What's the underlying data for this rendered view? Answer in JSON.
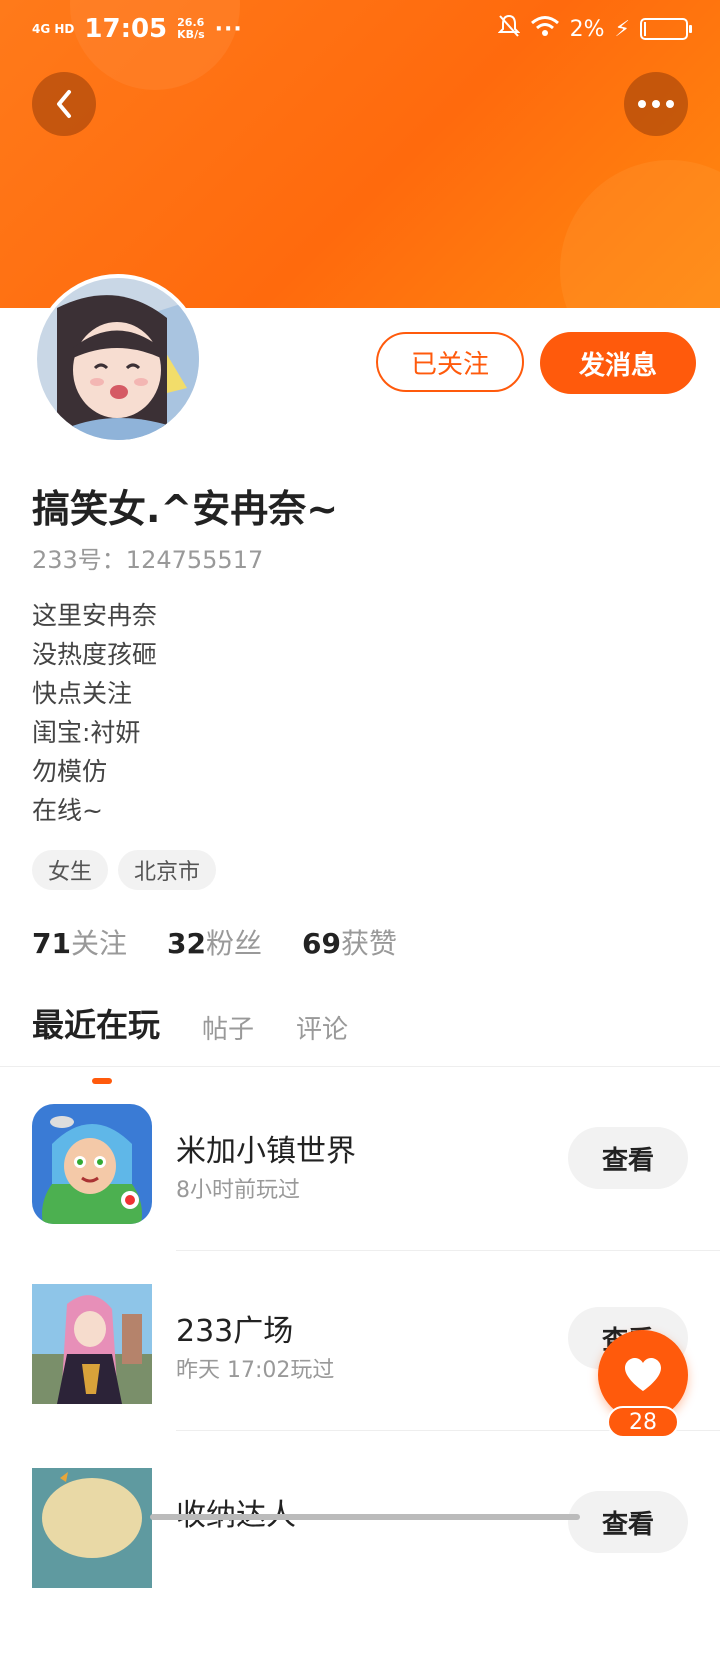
{
  "status_bar": {
    "network": "4G HD",
    "time": "17:05",
    "speed_value": "26.6",
    "speed_unit": "KB/s",
    "more": "···",
    "battery": "2%"
  },
  "profile": {
    "name": "搞笑女.^安冉奈~",
    "uid": "233号：124755517",
    "bio": [
      "这里安冉奈",
      "没热度孩砸",
      "快点关注",
      "闺宝:衬妍",
      "勿模仿",
      "在线~"
    ],
    "tags": [
      "女生",
      "北京市"
    ],
    "stats": [
      {
        "num": "71",
        "label": "关注"
      },
      {
        "num": "32",
        "label": "粉丝"
      },
      {
        "num": "69",
        "label": "获赞"
      }
    ]
  },
  "actions": {
    "follow_label": "已关注",
    "message_label": "发消息"
  },
  "tabs": [
    {
      "label": "最近在玩",
      "active": true
    },
    {
      "label": "帖子",
      "active": false
    },
    {
      "label": "评论",
      "active": false
    }
  ],
  "games": [
    {
      "title": "米加小镇世界",
      "sub": "8小时前玩过",
      "button": "查看"
    },
    {
      "title": "233广场",
      "sub": "昨天 17:02玩过",
      "button": "查看"
    },
    {
      "title": "收纳达人",
      "sub": "",
      "button": "查看"
    }
  ],
  "fab": {
    "count": "28"
  },
  "colors": {
    "accent": "#ff5a0c",
    "header": "#ff7a1a"
  }
}
